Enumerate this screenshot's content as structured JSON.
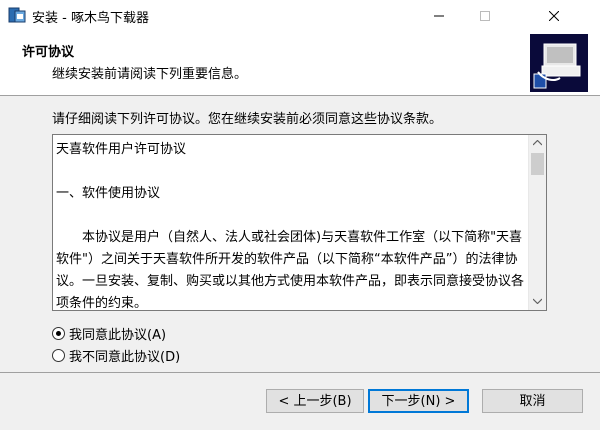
{
  "window": {
    "title": "安装 - 啄木鸟下载器"
  },
  "header": {
    "title": "许可协议",
    "subtitle": "继续安装前请阅读下列重要信息。"
  },
  "instruction": "请仔细阅读下列许可协议。您在继续安装前必须同意这些协议条款。",
  "license": {
    "lines": [
      "天喜软件用户许可协议",
      "",
      "一、软件使用协议",
      "",
      "　　本协议是用户（自然人、法人或社会团体)与天喜软件工作室（以下简称\"天喜软件\"）之间关于天喜软件所开发的软件产品（以下简称“本软件产品”）的法律协议。一旦安装、复制、购买或以其他方式使用本软件产品，即表示同意接受协议各项条件的约束。"
    ]
  },
  "radios": {
    "accept": "我同意此协议(A)",
    "decline": "我不同意此协议(D)",
    "selected": "accept"
  },
  "buttons": {
    "back": "< 上一步(B)",
    "next": "下一步(N) >",
    "cancel": "取消"
  },
  "colors": {
    "accent": "#0078d7",
    "logo_bg": "#0a0a3a"
  },
  "icons": {
    "app": "installer-app-icon",
    "logo": "computer-install-logo"
  }
}
